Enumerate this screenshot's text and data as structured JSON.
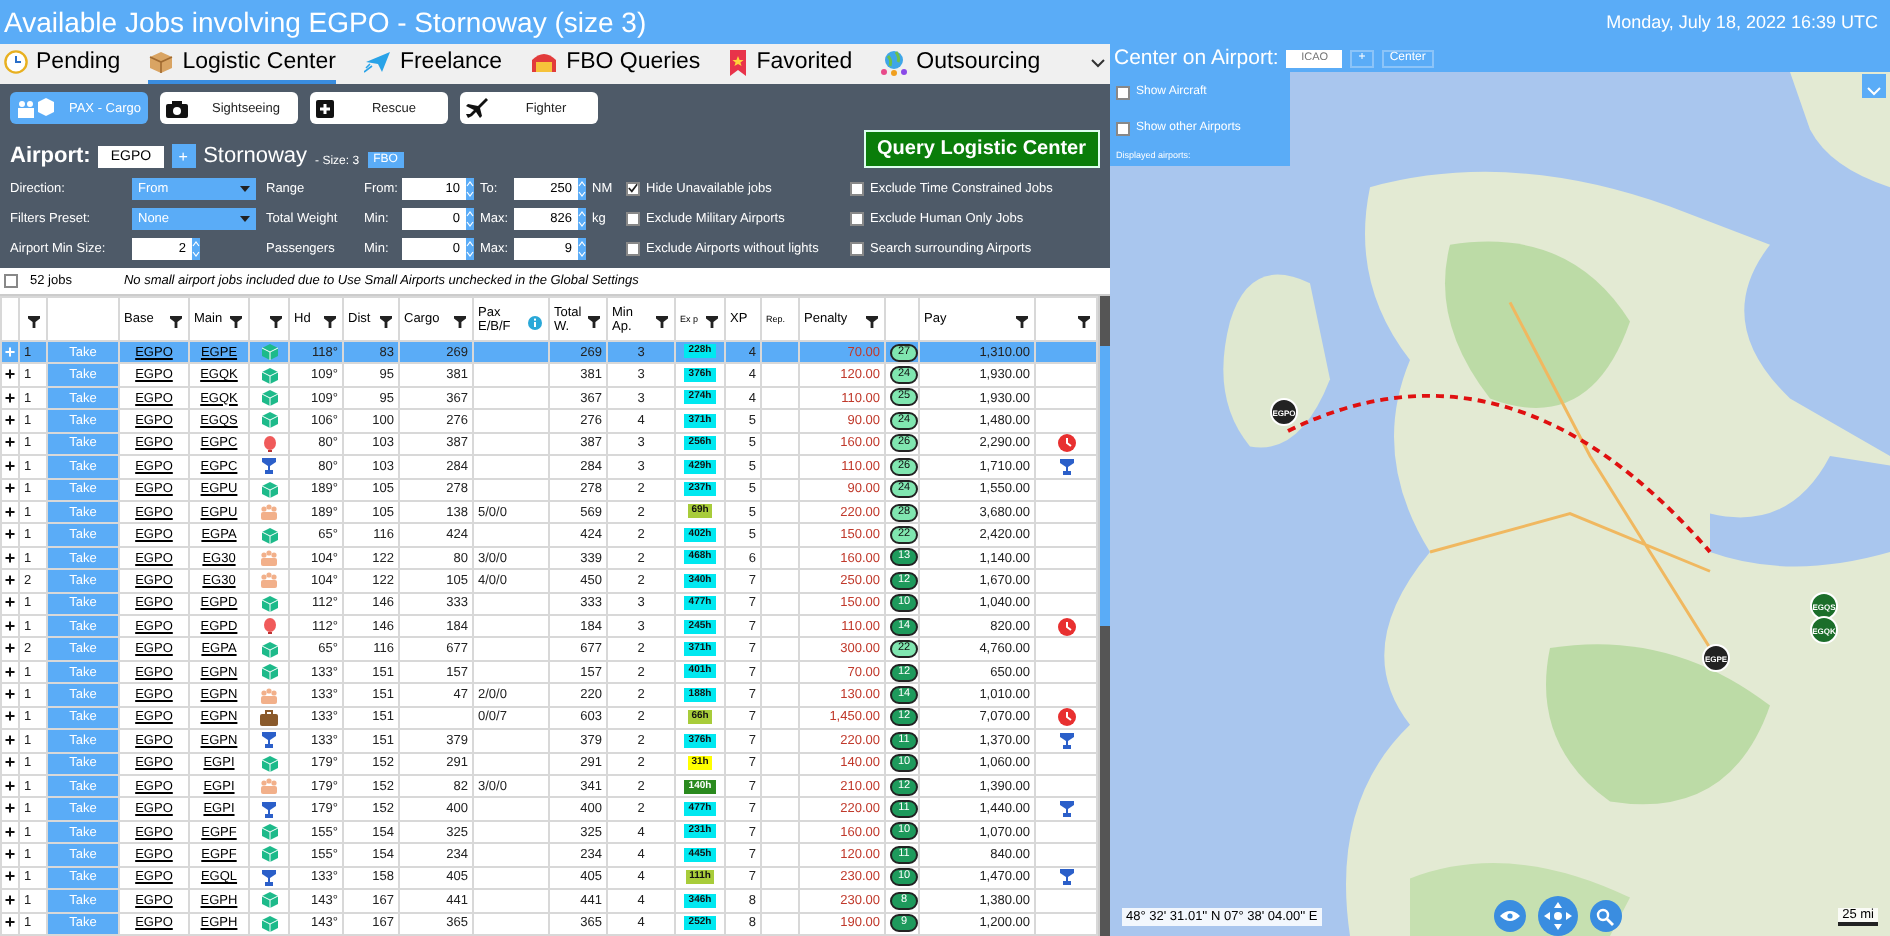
{
  "window": {
    "title": "Available Jobs involving EGPO - Stornoway (size 3)",
    "datetime": "Monday, July 18, 2022 16:39 UTC"
  },
  "tabs": [
    {
      "label": "Pending",
      "selected": false
    },
    {
      "label": "Logistic Center",
      "selected": true
    },
    {
      "label": "Freelance",
      "selected": false
    },
    {
      "label": "FBO Queries",
      "selected": false
    },
    {
      "label": "Favorited",
      "selected": false
    },
    {
      "label": "Outsourcing",
      "selected": false
    }
  ],
  "modes": [
    {
      "label": "PAX - Cargo",
      "selected": true
    },
    {
      "label": "Sightseeing",
      "selected": false
    },
    {
      "label": "Rescue",
      "selected": false
    },
    {
      "label": "Fighter",
      "selected": false
    }
  ],
  "airport": {
    "label": "Airport:",
    "icao": "EGPO",
    "add": "+",
    "name": "Stornoway",
    "size": "- Size: 3",
    "fbo": "FBO"
  },
  "query_button": "Query Logistic Center",
  "filters_left": [
    {
      "label": "Direction:",
      "kind": "dropdown",
      "value": "From"
    },
    {
      "label": "Filters Preset:",
      "kind": "dropdown",
      "value": "None"
    },
    {
      "label": "Airport Min Size:",
      "kind": "spin",
      "value": "2"
    }
  ],
  "ranges": [
    {
      "label": "Range",
      "min_label": "From:",
      "min": "10",
      "max_label": "To:",
      "max": "250",
      "unit": "NM"
    },
    {
      "label": "Total Weight",
      "min_label": "Min:",
      "min": "0",
      "max_label": "Max:",
      "max": "826",
      "unit": "kg"
    },
    {
      "label": "Passengers",
      "min_label": "Min:",
      "min": "0",
      "max_label": "Max:",
      "max": "9"
    }
  ],
  "options": [
    {
      "label": "Hide Unavailable jobs",
      "checked": true
    },
    {
      "label": "Exclude Time Constrained Jobs",
      "checked": false
    },
    {
      "label": "Exclude Military Airports",
      "checked": false
    },
    {
      "label": "Exclude Human Only Jobs",
      "checked": false
    },
    {
      "label": "Exclude Airports without lights",
      "checked": false
    },
    {
      "label": "Search surrounding Airports",
      "checked": false
    }
  ],
  "summary": {
    "select_all": false,
    "count": "52 jobs",
    "note": "No small airport jobs included due to Use Small Airports unchecked in the Global Settings"
  },
  "table": {
    "columns": [
      "Base",
      "Main",
      "Hd",
      "Dist",
      "Cargo",
      "Pax E/B/F",
      "Total W.",
      "Min Ap.",
      "Ex p",
      "XP",
      "Rep.",
      "Penalty",
      "Pay"
    ],
    "take_labels": [
      "Take",
      "Take",
      "Take",
      "Take",
      "Take",
      "Take",
      "Take",
      "Take",
      "Take",
      "Take",
      "Take",
      "Take",
      "Take",
      "Take",
      "Take",
      "Take",
      "Take",
      "Take",
      "Take",
      "Take",
      "Take",
      "Take",
      "Take",
      "Take",
      "Take",
      "Take"
    ],
    "expand_signs": [
      "+",
      "+",
      "+",
      "+",
      "+",
      "+",
      "+",
      "+",
      "+",
      "+",
      "+",
      "+",
      "+",
      "+",
      "+",
      "+",
      "+",
      "+",
      "+",
      "+",
      "+",
      "+",
      "+",
      "+",
      "+",
      "+"
    ],
    "rows": [
      {
        "selected": true,
        "qty": "1",
        "base": "EGPO",
        "main": "EGPE",
        "kind": "cargo",
        "hd": "118°",
        "dist": "83",
        "cargo": "269",
        "total": "269",
        "min_ap": "3",
        "exp": {
          "text": "228h",
          "color": "#00e8f0"
        },
        "xp": "4",
        "penalty": "70.00",
        "rating": {
          "text": "27",
          "color": "#80e6b0"
        },
        "pay": "1,310.00"
      },
      {
        "selected": false,
        "qty": "1",
        "base": "EGPO",
        "main": "EGQK",
        "kind": "cargo",
        "hd": "109°",
        "dist": "95",
        "cargo": "381",
        "total": "381",
        "min_ap": "3",
        "exp": {
          "text": "376h",
          "color": "#00e8f0"
        },
        "xp": "4",
        "penalty": "120.00",
        "rating": {
          "text": "24",
          "color": "#80e6b0"
        },
        "pay": "1,930.00"
      },
      {
        "selected": false,
        "qty": "1",
        "base": "EGPO",
        "main": "EGQK",
        "kind": "cargo",
        "hd": "109°",
        "dist": "95",
        "cargo": "367",
        "total": "367",
        "min_ap": "3",
        "exp": {
          "text": "274h",
          "color": "#00e8f0"
        },
        "xp": "4",
        "penalty": "110.00",
        "rating": {
          "text": "25",
          "color": "#80e6b0"
        },
        "pay": "1,930.00"
      },
      {
        "selected": false,
        "qty": "1",
        "base": "EGPO",
        "main": "EGQS",
        "kind": "cargo",
        "hd": "106°",
        "dist": "100",
        "cargo": "276",
        "total": "276",
        "min_ap": "4",
        "exp": {
          "text": "371h",
          "color": "#00e8f0"
        },
        "xp": "5",
        "penalty": "90.00",
        "rating": {
          "text": "24",
          "color": "#80e6b0"
        },
        "pay": "1,480.00"
      },
      {
        "selected": false,
        "qty": "1",
        "base": "EGPO",
        "main": "EGPC",
        "kind": "balloon",
        "hd": "80°",
        "dist": "103",
        "cargo": "387",
        "total": "387",
        "min_ap": "3",
        "exp": {
          "text": "256h",
          "color": "#00e8f0"
        },
        "xp": "5",
        "penalty": "160.00",
        "rating": {
          "text": "26",
          "color": "#80e6b0"
        },
        "pay": "2,290.00",
        "alert": {
          "kind": "clock"
        }
      },
      {
        "selected": false,
        "qty": "1",
        "base": "EGPO",
        "main": "EGPC",
        "kind": "trophy",
        "hd": "80°",
        "dist": "103",
        "cargo": "284",
        "total": "284",
        "min_ap": "3",
        "exp": {
          "text": "429h",
          "color": "#00e8f0"
        },
        "xp": "5",
        "penalty": "110.00",
        "rating": {
          "text": "26",
          "color": "#80e6b0"
        },
        "pay": "1,710.00",
        "alert": {
          "kind": "trophy"
        }
      },
      {
        "selected": false,
        "qty": "1",
        "base": "EGPO",
        "main": "EGPU",
        "kind": "cargo",
        "hd": "189°",
        "dist": "105",
        "cargo": "278",
        "total": "278",
        "min_ap": "2",
        "exp": {
          "text": "237h",
          "color": "#00e8f0"
        },
        "xp": "5",
        "penalty": "90.00",
        "rating": {
          "text": "24",
          "color": "#80e6b0"
        },
        "pay": "1,550.00"
      },
      {
        "selected": false,
        "qty": "1",
        "base": "EGPO",
        "main": "EGPU",
        "kind": "pax",
        "hd": "189°",
        "dist": "105",
        "cargo": "138",
        "pax": "5/0/0",
        "total": "569",
        "min_ap": "2",
        "exp": {
          "text": "69h",
          "color": "#a8cc3a"
        },
        "xp": "5",
        "penalty": "220.00",
        "rating": {
          "text": "28",
          "color": "#80e6b0"
        },
        "pay": "3,680.00"
      },
      {
        "selected": false,
        "qty": "1",
        "base": "EGPO",
        "main": "EGPA",
        "kind": "cargo",
        "hd": "65°",
        "dist": "116",
        "cargo": "424",
        "total": "424",
        "min_ap": "2",
        "exp": {
          "text": "402h",
          "color": "#00e8f0"
        },
        "xp": "5",
        "penalty": "150.00",
        "rating": {
          "text": "22",
          "color": "#80e6b0"
        },
        "pay": "2,420.00"
      },
      {
        "selected": false,
        "qty": "1",
        "base": "EGPO",
        "main": "EG30",
        "kind": "pax",
        "hd": "104°",
        "dist": "122",
        "cargo": "80",
        "pax": "3/0/0",
        "total": "339",
        "min_ap": "2",
        "exp": {
          "text": "468h",
          "color": "#00e8f0"
        },
        "xp": "6",
        "penalty": "160.00",
        "rating": {
          "text": "13",
          "color": "#1e9a5c"
        },
        "pay": "1,140.00"
      },
      {
        "selected": false,
        "qty": "2",
        "base": "EGPO",
        "main": "EG30",
        "kind": "pax",
        "hd": "104°",
        "dist": "122",
        "cargo": "105",
        "pax": "4/0/0",
        "total": "450",
        "min_ap": "2",
        "exp": {
          "text": "340h",
          "color": "#00e8f0"
        },
        "xp": "7",
        "penalty": "250.00",
        "rating": {
          "text": "12",
          "color": "#1e9a5c"
        },
        "pay": "1,670.00"
      },
      {
        "selected": false,
        "qty": "1",
        "base": "EGPO",
        "main": "EGPD",
        "kind": "cargo",
        "hd": "112°",
        "dist": "146",
        "cargo": "333",
        "total": "333",
        "min_ap": "3",
        "exp": {
          "text": "477h",
          "color": "#00e8f0"
        },
        "xp": "7",
        "penalty": "150.00",
        "rating": {
          "text": "10",
          "color": "#1e9a5c"
        },
        "pay": "1,040.00"
      },
      {
        "selected": false,
        "qty": "1",
        "base": "EGPO",
        "main": "EGPD",
        "kind": "balloon",
        "hd": "112°",
        "dist": "146",
        "cargo": "184",
        "total": "184",
        "min_ap": "3",
        "exp": {
          "text": "245h",
          "color": "#00e8f0"
        },
        "xp": "7",
        "penalty": "110.00",
        "rating": {
          "text": "14",
          "color": "#1e9a5c"
        },
        "pay": "820.00",
        "alert": {
          "kind": "clock"
        }
      },
      {
        "selected": false,
        "qty": "2",
        "base": "EGPO",
        "main": "EGPA",
        "kind": "cargo",
        "hd": "65°",
        "dist": "116",
        "cargo": "677",
        "total": "677",
        "min_ap": "2",
        "exp": {
          "text": "371h",
          "color": "#00e8f0"
        },
        "xp": "7",
        "penalty": "300.00",
        "rating": {
          "text": "22",
          "color": "#80e6b0"
        },
        "pay": "4,760.00"
      },
      {
        "selected": false,
        "qty": "1",
        "base": "EGPO",
        "main": "EGPN",
        "kind": "cargo",
        "hd": "133°",
        "dist": "151",
        "cargo": "157",
        "total": "157",
        "min_ap": "2",
        "exp": {
          "text": "401h",
          "color": "#00e8f0"
        },
        "xp": "7",
        "penalty": "70.00",
        "rating": {
          "text": "12",
          "color": "#1e9a5c"
        },
        "pay": "650.00"
      },
      {
        "selected": false,
        "qty": "1",
        "base": "EGPO",
        "main": "EGPN",
        "kind": "pax",
        "hd": "133°",
        "dist": "151",
        "cargo": "47",
        "pax": "2/0/0",
        "total": "220",
        "min_ap": "2",
        "exp": {
          "text": "188h",
          "color": "#00e8f0"
        },
        "xp": "7",
        "penalty": "130.00",
        "rating": {
          "text": "14",
          "color": "#1e9a5c"
        },
        "pay": "1,010.00"
      },
      {
        "selected": false,
        "qty": "1",
        "base": "EGPO",
        "main": "EGPN",
        "kind": "briefcase",
        "hd": "133°",
        "dist": "151",
        "pax": "0/0/7",
        "total": "603",
        "min_ap": "2",
        "exp": {
          "text": "66h",
          "color": "#a8cc3a"
        },
        "xp": "7",
        "penalty": "1,450.00",
        "rating": {
          "text": "12",
          "color": "#1e9a5c"
        },
        "pay": "7,070.00",
        "alert": {
          "kind": "clock"
        }
      },
      {
        "selected": false,
        "qty": "1",
        "base": "EGPO",
        "main": "EGPN",
        "kind": "trophy",
        "hd": "133°",
        "dist": "151",
        "cargo": "379",
        "total": "379",
        "min_ap": "2",
        "exp": {
          "text": "376h",
          "color": "#00e8f0"
        },
        "xp": "7",
        "penalty": "220.00",
        "rating": {
          "text": "11",
          "color": "#1e9a5c"
        },
        "pay": "1,370.00",
        "alert": {
          "kind": "trophy"
        }
      },
      {
        "selected": false,
        "qty": "1",
        "base": "EGPO",
        "main": "EGPI",
        "kind": "cargo",
        "hd": "179°",
        "dist": "152",
        "cargo": "291",
        "total": "291",
        "min_ap": "2",
        "exp": {
          "text": "31h",
          "color": "#ffff00"
        },
        "xp": "7",
        "penalty": "140.00",
        "rating": {
          "text": "10",
          "color": "#1e9a5c"
        },
        "pay": "1,060.00"
      },
      {
        "selected": false,
        "qty": "1",
        "base": "EGPO",
        "main": "EGPI",
        "kind": "pax",
        "hd": "179°",
        "dist": "152",
        "cargo": "82",
        "pax": "3/0/0",
        "total": "341",
        "min_ap": "2",
        "exp": {
          "text": "140h",
          "color": "#2a8a1e"
        },
        "xp": "7",
        "penalty": "210.00",
        "rating": {
          "text": "12",
          "color": "#1e9a5c"
        },
        "pay": "1,390.00"
      },
      {
        "selected": false,
        "qty": "1",
        "base": "EGPO",
        "main": "EGPI",
        "kind": "trophy",
        "hd": "179°",
        "dist": "152",
        "cargo": "400",
        "total": "400",
        "min_ap": "2",
        "exp": {
          "text": "477h",
          "color": "#00e8f0"
        },
        "xp": "7",
        "penalty": "220.00",
        "rating": {
          "text": "11",
          "color": "#1e9a5c"
        },
        "pay": "1,440.00",
        "alert": {
          "kind": "trophy"
        }
      },
      {
        "selected": false,
        "qty": "1",
        "base": "EGPO",
        "main": "EGPF",
        "kind": "cargo",
        "hd": "155°",
        "dist": "154",
        "cargo": "325",
        "total": "325",
        "min_ap": "4",
        "exp": {
          "text": "231h",
          "color": "#00e8f0"
        },
        "xp": "7",
        "penalty": "160.00",
        "rating": {
          "text": "10",
          "color": "#1e9a5c"
        },
        "pay": "1,070.00"
      },
      {
        "selected": false,
        "qty": "1",
        "base": "EGPO",
        "main": "EGPF",
        "kind": "cargo",
        "hd": "155°",
        "dist": "154",
        "cargo": "234",
        "total": "234",
        "min_ap": "4",
        "exp": {
          "text": "445h",
          "color": "#00e8f0"
        },
        "xp": "7",
        "penalty": "120.00",
        "rating": {
          "text": "11",
          "color": "#1e9a5c"
        },
        "pay": "840.00"
      },
      {
        "selected": false,
        "qty": "1",
        "base": "EGPO",
        "main": "EGQL",
        "kind": "trophy",
        "hd": "133°",
        "dist": "158",
        "cargo": "405",
        "total": "405",
        "min_ap": "4",
        "exp": {
          "text": "111h",
          "color": "#a8cc3a"
        },
        "xp": "7",
        "penalty": "230.00",
        "rating": {
          "text": "10",
          "color": "#1e9a5c"
        },
        "pay": "1,470.00",
        "alert": {
          "kind": "trophy"
        }
      },
      {
        "selected": false,
        "qty": "1",
        "base": "EGPO",
        "main": "EGPH",
        "kind": "cargo",
        "hd": "143°",
        "dist": "167",
        "cargo": "441",
        "total": "441",
        "min_ap": "4",
        "exp": {
          "text": "346h",
          "color": "#00e8f0"
        },
        "xp": "8",
        "penalty": "230.00",
        "rating": {
          "text": "8",
          "color": "#1e9a5c"
        },
        "pay": "1,380.00"
      },
      {
        "selected": false,
        "qty": "1",
        "base": "EGPO",
        "main": "EGPH",
        "kind": "cargo",
        "hd": "143°",
        "dist": "167",
        "cargo": "365",
        "total": "365",
        "min_ap": "4",
        "exp": {
          "text": "252h",
          "color": "#00e8f0"
        },
        "xp": "8",
        "penalty": "190.00",
        "rating": {
          "text": "9",
          "color": "#1e9a5c"
        },
        "pay": "1,200.00"
      }
    ]
  },
  "map": {
    "center_label": "Center on Airport:",
    "icao_placeholder": "ICAO",
    "add": "+",
    "center_button": "Center",
    "layers": [
      {
        "label": "Show Aircraft",
        "checked": false
      },
      {
        "label": "Show other Airports",
        "checked": false
      }
    ],
    "displayed_label": "Displayed airports:",
    "markers": [
      {
        "code": "EGPO",
        "kind": "origin"
      },
      {
        "code": "EGPE",
        "kind": "destination"
      },
      {
        "code": "EGQS",
        "kind": "other"
      },
      {
        "code": "EGQK",
        "kind": "other"
      }
    ],
    "coordinates": "48° 32' 31.01'' N 07° 38' 04.00'' E",
    "scale": "25 mi"
  }
}
